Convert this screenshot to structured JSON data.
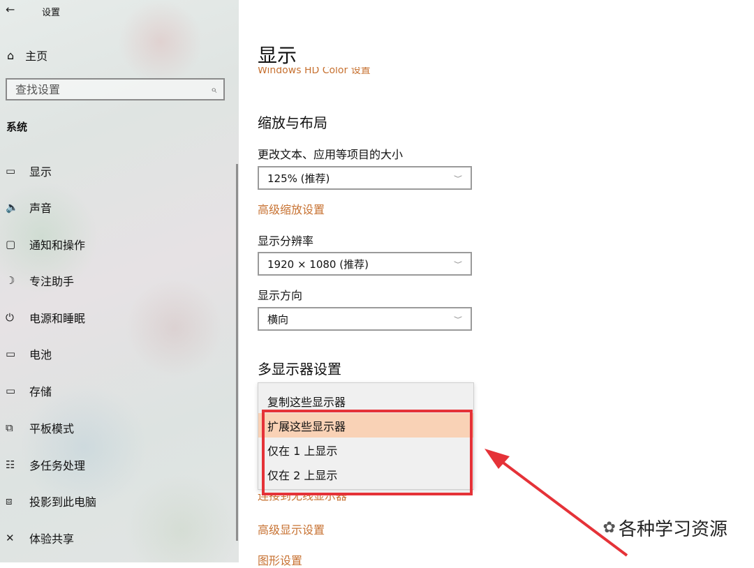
{
  "sidebar": {
    "back_icon": "←",
    "window_title": "设置",
    "home": {
      "icon": "⌂",
      "label": "主页"
    },
    "search": {
      "placeholder": "查找设置",
      "icon": "⌕"
    },
    "section_title": "系统",
    "items": [
      {
        "icon": "▭",
        "label": "显示"
      },
      {
        "icon": "🔈",
        "label": "声音"
      },
      {
        "icon": "▢",
        "label": "通知和操作"
      },
      {
        "icon": "☽",
        "label": "专注助手"
      },
      {
        "icon": "⏻",
        "label": "电源和睡眠"
      },
      {
        "icon": "▭",
        "label": "电池"
      },
      {
        "icon": "▭",
        "label": "存储"
      },
      {
        "icon": "⧉",
        "label": "平板模式"
      },
      {
        "icon": "☷",
        "label": "多任务处理"
      },
      {
        "icon": "⧈",
        "label": "投影到此电脑"
      },
      {
        "icon": "✕",
        "label": "体验共享"
      }
    ]
  },
  "main": {
    "title": "显示",
    "hdr_link": "Windows HD Color 设置",
    "scale_section": "缩放与布局",
    "text_size_label": "更改文本、应用等项目的大小",
    "text_size_value": "125% (推荐)",
    "adv_scale_link": "高级缩放设置",
    "resolution_label": "显示分辨率",
    "resolution_value": "1920 × 1080 (推荐)",
    "orientation_label": "显示方向",
    "orientation_value": "横向",
    "multi_section": "多显示器设置",
    "dropdown_options": [
      "复制这些显示器",
      "扩展这些显示器",
      "仅在 1 上显示",
      "仅在 2 上显示"
    ],
    "selected_option": "扩展这些显示器",
    "wireless_link": "连接到无线显示器",
    "adv_display_link": "高级显示设置",
    "graphics_link": "图形设置"
  },
  "colors": {
    "accent_link": "#c77232",
    "highlight": "#e53238",
    "selected_bg": "#f9d2b6"
  },
  "watermark": {
    "icon": "wechat-icon",
    "text": "各种学习资源"
  }
}
